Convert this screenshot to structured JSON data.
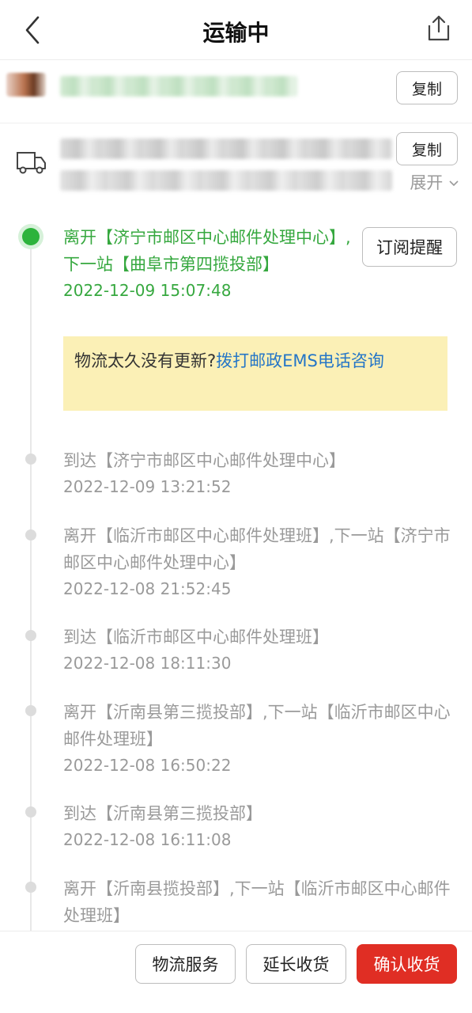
{
  "header": {
    "title": "运输中",
    "back_icon": "chevron-left-icon",
    "share_icon": "share-icon"
  },
  "receiver": {
    "copy_label": "复制"
  },
  "address": {
    "copy_label": "复制",
    "expand_label": "展开",
    "icon": "truck-icon"
  },
  "tracking": {
    "subscribe_label": "订阅提醒",
    "events": [
      {
        "text": "离开【济宁市邮区中心邮件处理中心】,下一站【曲阜市第四揽投部】",
        "time": "2022-12-09 15:07:48",
        "active": true
      },
      {
        "text": "到达【济宁市邮区中心邮件处理中心】",
        "time": "2022-12-09 13:21:52"
      },
      {
        "text": "离开【临沂市邮区中心邮件处理班】,下一站【济宁市邮区中心邮件处理中心】",
        "time": "2022-12-08 21:52:45"
      },
      {
        "text": "到达【临沂市邮区中心邮件处理班】",
        "time": "2022-12-08 18:11:30"
      },
      {
        "text": "离开【沂南县第三揽投部】,下一站【临沂市邮区中心邮件处理班】",
        "time": "2022-12-08 16:50:22"
      },
      {
        "text": "到达【沂南县第三揽投部】",
        "time": "2022-12-08 16:11:08"
      },
      {
        "text": "离开【沂南县揽投部】,下一站【临沂市邮区中心邮件处理班】",
        "time": ""
      }
    ]
  },
  "notice": {
    "text": "物流太久没有更新?",
    "link": "拨打邮政EMS电话咨询"
  },
  "actions": {
    "logistics_service": "物流服务",
    "extend_receipt": "延长收货",
    "confirm_receipt": "确认收货"
  },
  "colors": {
    "active_green": "#36a83f",
    "confirm_red": "#e02e24",
    "link_blue": "#2576c7",
    "notice_bg": "#fbf0b6"
  }
}
